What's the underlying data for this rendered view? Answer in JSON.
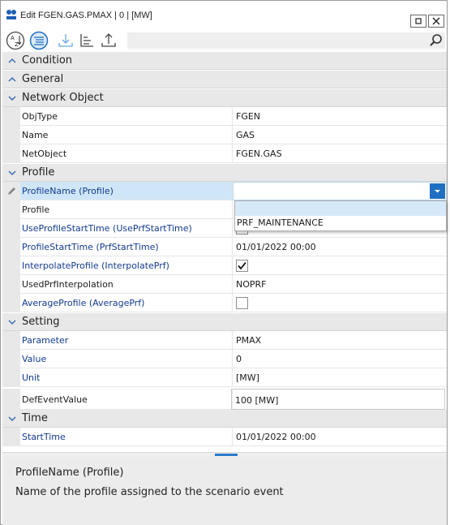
{
  "window": {
    "title": "Edit FGEN.GAS.PMAX | 0 | [MW]",
    "maximize_glyph": "▫",
    "close_glyph": "✕"
  },
  "toolbar": {
    "buttons": [
      "sort-az-icon",
      "categorize-icon",
      "download-icon",
      "hierarchy-icon",
      "upload-icon"
    ],
    "search_value": "",
    "accent_color": "#1e6fc2"
  },
  "categories": {
    "condition": "Condition",
    "general": "General",
    "network_object": "Network Object",
    "profile": "Profile",
    "setting": "Setting",
    "time": "Time"
  },
  "network_object": {
    "objtype": {
      "name": "ObjType",
      "value": "FGEN"
    },
    "name": {
      "name": "Name",
      "value": "GAS"
    },
    "netobject": {
      "name": "NetObject",
      "value": "FGEN.GAS"
    }
  },
  "profile": {
    "profile_name": {
      "name": "ProfileName (Profile)",
      "value": ""
    },
    "profile": {
      "name": "Profile",
      "value": ""
    },
    "use_start": {
      "name": "UseProfileStartTime (UsePrfStartTime)",
      "checked": false
    },
    "start_time": {
      "name": "ProfileStartTime (PrfStartTime)",
      "value": "01/01/2022 00:00"
    },
    "interpolate": {
      "name": "InterpolateProfile (InterpolatePrf)",
      "checked": true
    },
    "used_interp": {
      "name": "UsedPrfInterpolation",
      "value": "NOPRF"
    },
    "average": {
      "name": "AverageProfile (AveragePrf)",
      "checked": false
    }
  },
  "dropdown": {
    "options": [
      "",
      "PRF_MAINTENANCE"
    ]
  },
  "setting": {
    "parameter": {
      "name": "Parameter",
      "value": "PMAX"
    },
    "value": {
      "name": "Value",
      "value": "0"
    },
    "unit": {
      "name": "Unit",
      "value": "[MW]"
    },
    "def_event": {
      "name": "DefEventValue",
      "value": "100 [MW]"
    }
  },
  "time": {
    "start_time": {
      "name": "StartTime",
      "value": "01/01/2022 00:00"
    }
  },
  "description": {
    "title": "ProfileName (Profile)",
    "text": "Name of the profile assigned to the scenario event"
  }
}
